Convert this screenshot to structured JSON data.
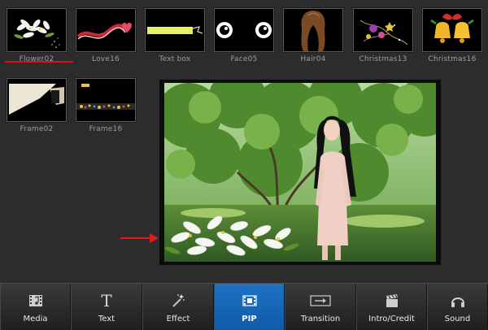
{
  "app": {
    "thumbnails": [
      {
        "id": "flower02",
        "label": "Flower02",
        "icon": "flower-sticker-icon",
        "selected": true
      },
      {
        "id": "love16",
        "label": "Love16",
        "icon": "heart-ribbon-icon"
      },
      {
        "id": "textbox",
        "label": "Text box",
        "icon": "text-box-bar-icon"
      },
      {
        "id": "face05",
        "label": "Face05",
        "icon": "cartoon-eyes-icon"
      },
      {
        "id": "hair04",
        "label": "Hair04",
        "icon": "hair-wig-icon"
      },
      {
        "id": "christmas13",
        "label": "Christmas13",
        "icon": "christmas-ornaments-icon"
      },
      {
        "id": "christmas16",
        "label": "Christmas16",
        "icon": "christmas-bells-icon"
      },
      {
        "id": "frame02",
        "label": "Frame02",
        "icon": "frame-corner-icon"
      },
      {
        "id": "frame16",
        "label": "Frame16",
        "icon": "frame-strip-icon"
      }
    ]
  },
  "toolbar": {
    "buttons": [
      {
        "id": "media",
        "label": "Media",
        "icon": "film-music-icon"
      },
      {
        "id": "text",
        "label": "Text",
        "icon": "text-t-icon"
      },
      {
        "id": "effect",
        "label": "Effect",
        "icon": "magic-wand-icon"
      },
      {
        "id": "pip",
        "label": "PIP",
        "icon": "pip-film-icon",
        "active": true
      },
      {
        "id": "transition",
        "label": "Transition",
        "icon": "transition-arrows-icon"
      },
      {
        "id": "intro",
        "label": "Intro/Credit",
        "icon": "clapperboard-icon"
      },
      {
        "id": "sound",
        "label": "Sound",
        "icon": "headphones-icon"
      }
    ]
  },
  "colors": {
    "accent_active": "#1a6cc0",
    "underline_red": "#d4141b",
    "arrow_red": "#e01b1b"
  }
}
